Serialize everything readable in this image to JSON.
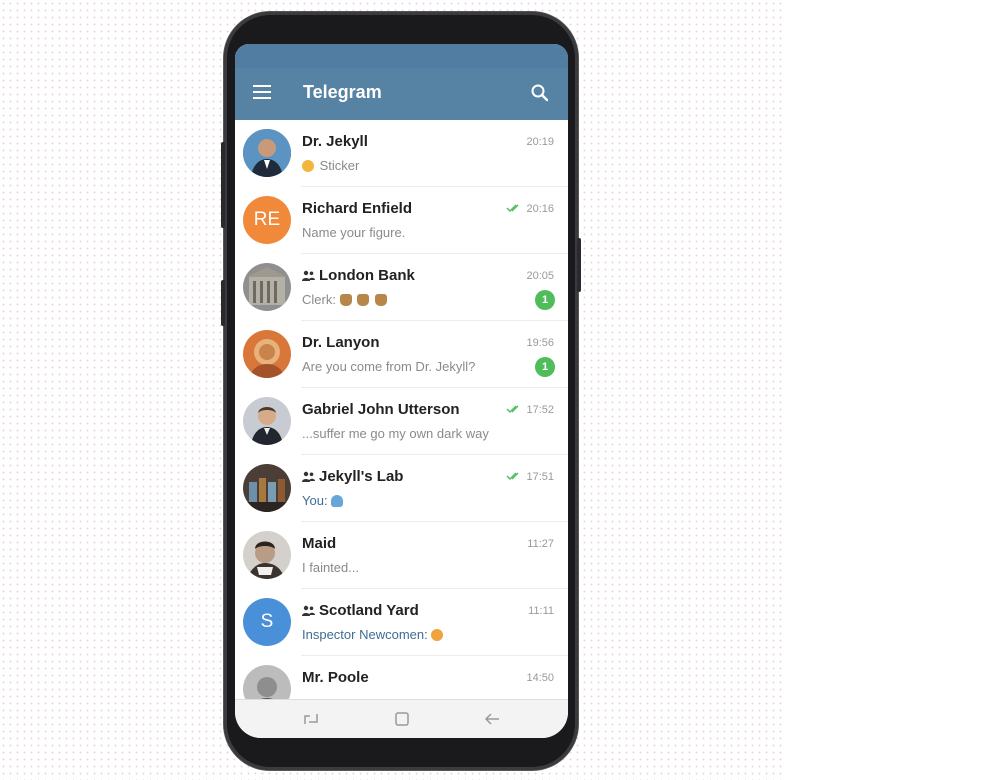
{
  "app_bar": {
    "title": "Telegram"
  },
  "colors": {
    "header": "#5682a3",
    "status_bar": "#517da2",
    "badge": "#4fbe5a",
    "check": "#4fbe5a",
    "avatar_re": "#f0893a",
    "avatar_s": "#4a90d9"
  },
  "chats": [
    {
      "name": "Dr. Jekyll",
      "time": "20:19",
      "preview": "Sticker",
      "preview_icon": "sticker-emoji-icon",
      "group": false,
      "read": false,
      "unread": "",
      "avatar_initials": ""
    },
    {
      "name": "Richard Enfield",
      "time": "20:16",
      "preview": "Name your figure.",
      "group": false,
      "read": true,
      "unread": "",
      "avatar_initials": "RE"
    },
    {
      "name": "London Bank",
      "time": "20:05",
      "preview_prefix": "Clerk: ",
      "preview": "",
      "preview_icon": "money-bag-emoji-icon",
      "group": true,
      "read": false,
      "unread": "1",
      "avatar_initials": ""
    },
    {
      "name": "Dr. Lanyon",
      "time": "19:56",
      "preview": "Are you come from Dr. Jekyll?",
      "group": false,
      "read": false,
      "unread": "1",
      "avatar_initials": ""
    },
    {
      "name": "Gabriel John Utterson",
      "time": "17:52",
      "preview": "...suffer me go my own dark way",
      "group": false,
      "read": true,
      "unread": "",
      "avatar_initials": ""
    },
    {
      "name": "Jekyll's Lab",
      "time": "17:51",
      "preview_prefix": "You: ",
      "preview": "",
      "preview_icon": "water-emoji-icon",
      "group": true,
      "read": true,
      "unread": "",
      "avatar_initials": ""
    },
    {
      "name": "Maid",
      "time": "11:27",
      "preview": "I fainted...",
      "group": false,
      "read": false,
      "unread": "",
      "avatar_initials": ""
    },
    {
      "name": "Scotland Yard",
      "time": "11:11",
      "preview_prefix": "Inspector Newcomen: ",
      "preview": "",
      "preview_icon": "smile-emoji-icon",
      "group": true,
      "read": false,
      "unread": "",
      "avatar_initials": "S"
    },
    {
      "name": "Mr. Poole",
      "time": "14:50",
      "preview": "",
      "group": false,
      "read": false,
      "unread": "",
      "avatar_initials": ""
    }
  ]
}
